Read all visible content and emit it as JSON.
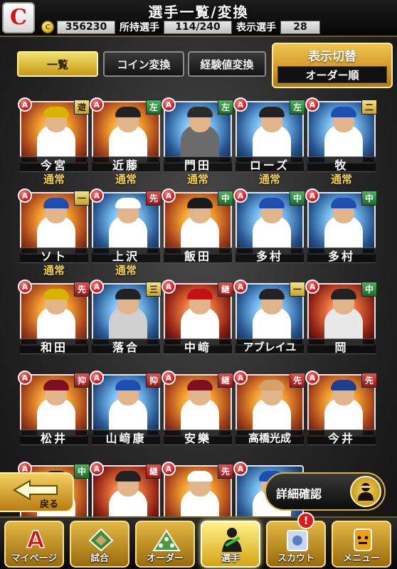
{
  "header": {
    "team_logo": "C",
    "title": "選手一覧/変換",
    "coins": "356230",
    "owned_label": "所持選手",
    "owned_value": "114/240",
    "shown_label": "表示選手",
    "shown_value": "28"
  },
  "tabs": {
    "list": "一覧",
    "coin_convert": "コイン変換",
    "exp_convert": "経験値変換"
  },
  "display_toggle": {
    "label": "表示切替",
    "value": "オーダー順"
  },
  "badge_letter": "A",
  "players": [
    {
      "name": "今宮",
      "pos": "遊",
      "pos_color": "yellow",
      "status": "通常",
      "cap": "#d8b400",
      "uni": "#ffffff",
      "bg": "a"
    },
    {
      "name": "近藤",
      "pos": "左",
      "pos_color": "green",
      "status": "通常",
      "cap": "#222222",
      "uni": "#ffffff",
      "bg": "a"
    },
    {
      "name": "門田",
      "pos": "左",
      "pos_color": "green",
      "status": "通常",
      "cap": "#2b2b2b",
      "uni": "#6b6b6b",
      "bg": "b"
    },
    {
      "name": "ローズ",
      "pos": "左",
      "pos_color": "green",
      "status": "通常",
      "cap": "#222222",
      "uni": "#ffffff",
      "bg": "b"
    },
    {
      "name": "牧",
      "pos": "二",
      "pos_color": "yellow",
      "status": "通常",
      "cap": "#1e4fb0",
      "uni": "#ffffff",
      "bg": "b"
    },
    {
      "name": "ソト",
      "pos": "一",
      "pos_color": "yellow",
      "status": "通常",
      "cap": "#1e4fb0",
      "uni": "#ffffff",
      "bg": "a"
    },
    {
      "name": "上沢",
      "pos": "先",
      "pos_color": "red",
      "status": "通常",
      "cap": "#ffffff",
      "uni": "#ffffff",
      "bg": "b"
    },
    {
      "name": "飯田",
      "pos": "中",
      "pos_color": "green",
      "status": "",
      "cap": "#1a1a1a",
      "uni": "#ffffff",
      "bg": "a"
    },
    {
      "name": "多村",
      "pos": "中",
      "pos_color": "green",
      "status": "",
      "cap": "#1e4fb0",
      "uni": "#ffffff",
      "bg": "b"
    },
    {
      "name": "多村",
      "pos": "中",
      "pos_color": "green",
      "status": "",
      "cap": "#1e4fb0",
      "uni": "#ffffff",
      "bg": "b"
    },
    {
      "name": "和田",
      "pos": "先",
      "pos_color": "red",
      "status": "",
      "cap": "#d8b400",
      "uni": "#ffffff",
      "bg": "a"
    },
    {
      "name": "落合",
      "pos": "三",
      "pos_color": "yellow",
      "status": "",
      "cap": "#222222",
      "uni": "#cfcfcf",
      "bg": "b"
    },
    {
      "name": "中﨑",
      "pos": "継",
      "pos_color": "red",
      "status": "",
      "cap": "#c21212",
      "uni": "#ffffff",
      "bg": "c"
    },
    {
      "name": "アブレイユ",
      "pos": "一",
      "pos_color": "yellow",
      "status": "",
      "cap": "#222222",
      "uni": "#ffffff",
      "bg": "b"
    },
    {
      "name": "岡",
      "pos": "中",
      "pos_color": "green",
      "status": "",
      "cap": "#222222",
      "uni": "#e8e8e8",
      "bg": "c"
    },
    {
      "name": "松井",
      "pos": "抑",
      "pos_color": "red",
      "status": "",
      "cap": "#7a1020",
      "uni": "#ffffff",
      "bg": "a"
    },
    {
      "name": "山﨑康",
      "pos": "抑",
      "pos_color": "red",
      "status": "",
      "cap": "#1e4fb0",
      "uni": "#ffffff",
      "bg": "b"
    },
    {
      "name": "安樂",
      "pos": "継",
      "pos_color": "red",
      "status": "",
      "cap": "#7a1020",
      "uni": "#ffffff",
      "bg": "a"
    },
    {
      "name": "高橋光成",
      "pos": "先",
      "pos_color": "red",
      "status": "",
      "cap": "#d6a06a",
      "uni": "#ffffff",
      "bg": "a"
    },
    {
      "name": "今井",
      "pos": "先",
      "pos_color": "red",
      "status": "",
      "cap": "#1e3f8f",
      "uni": "#ffffff",
      "bg": "a"
    },
    {
      "name": "",
      "pos": "中",
      "pos_color": "green",
      "status": "",
      "cap": "#222222",
      "uni": "#ffffff",
      "bg": "a"
    },
    {
      "name": "",
      "pos": "継",
      "pos_color": "red",
      "status": "",
      "cap": "#222222",
      "uni": "#ffffff",
      "bg": "c"
    },
    {
      "name": "",
      "pos": "先",
      "pos_color": "red",
      "status": "",
      "cap": "#ffffff",
      "uni": "#ffffff",
      "bg": "a"
    },
    {
      "name": "",
      "pos": "",
      "pos_color": "",
      "status": "",
      "cap": "#1e4fb0",
      "uni": "#ffffff",
      "bg": "b"
    }
  ],
  "back_button": "戻る",
  "detail_button": "詳細確認",
  "nav": [
    {
      "label": "マイページ",
      "icon": "mypage-icon"
    },
    {
      "label": "試合",
      "icon": "stadium-icon"
    },
    {
      "label": "オーダー",
      "icon": "field-order-icon"
    },
    {
      "label": "選手",
      "icon": "player-icon"
    },
    {
      "label": "スカウト",
      "icon": "scout-icon"
    },
    {
      "label": "メニュー",
      "icon": "menu-icon"
    }
  ],
  "scout_notification": "!"
}
